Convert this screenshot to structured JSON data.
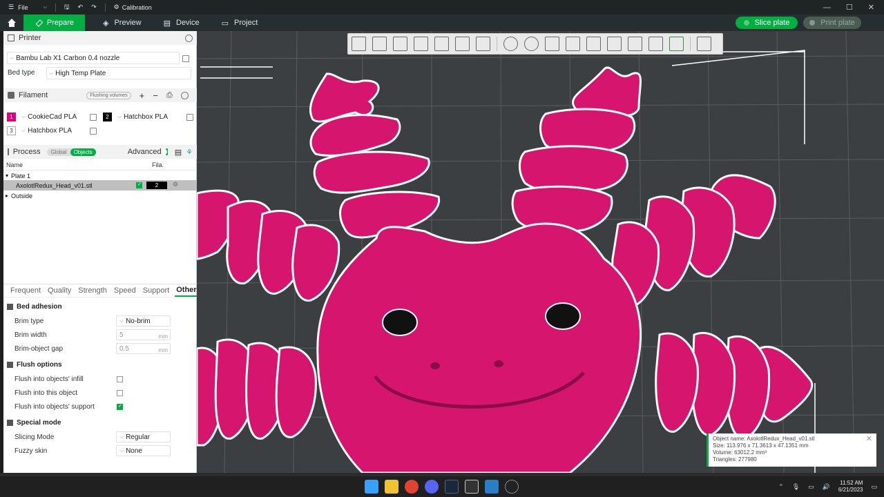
{
  "titlebar": {
    "file_label": "File",
    "project_name": "Calibration",
    "minimize_label": "—",
    "maximize_label": "☐",
    "close_label": "✕"
  },
  "tabs": {
    "prepare": "Prepare",
    "preview": "Preview",
    "device": "Device",
    "project": "Project",
    "slice_plate": "Slice plate",
    "print_plate": "Print plate"
  },
  "printer": {
    "section_title": "Printer",
    "printer_name": "Bambu Lab X1 Carbon 0.4 nozzle",
    "bed_type_label": "Bed type",
    "bed_type_value": "High Temp Plate"
  },
  "filament": {
    "section_title": "Filament",
    "flushing_volumes": "Flushing volumes",
    "slots": [
      {
        "index": "1",
        "name": "CookieCad PLA",
        "color": "#e0007a"
      },
      {
        "index": "2",
        "name": "Hatchbox PLA",
        "color": "#000000"
      },
      {
        "index": "3",
        "name": "Hatchbox PLA",
        "color": "#ffffff"
      }
    ]
  },
  "process": {
    "section_title": "Process",
    "global_label": "Global",
    "objects_label": "Objects",
    "advanced_label": "Advanced",
    "col_name": "Name",
    "col_fila": "Fila.",
    "plate_label": "Plate 1",
    "object_name": "AxolotlRedux_Head_v01.stl",
    "object_fila": "2",
    "outside_label": "Outside"
  },
  "param_tabs": [
    "Frequent",
    "Quality",
    "Strength",
    "Speed",
    "Support",
    "Others"
  ],
  "others": {
    "bed_adhesion": "Bed adhesion",
    "brim_type_label": "Brim type",
    "brim_type_value": "No-brim",
    "brim_width_label": "Brim width",
    "brim_width_value": "5",
    "brim_gap_label": "Brim-object gap",
    "brim_gap_value": "0.5",
    "unit_mm": "mm",
    "flush_options": "Flush options",
    "flush_infill_label": "Flush into objects' infill",
    "flush_object_label": "Flush into this object",
    "flush_support_label": "Flush into objects' support",
    "special_mode": "Special mode",
    "slicing_mode_label": "Slicing Mode",
    "slicing_mode_value": "Regular",
    "fuzzy_skin_label": "Fuzzy skin",
    "fuzzy_skin_value": "None"
  },
  "object_info": {
    "name": "Object name: AxolotlRedux_Head_v01.stl",
    "size": "Size: 113.976 x 71.3613 x 47.1351 mm",
    "volume": "Volume: 63012.2 mm³",
    "triangles": "Triangles: 277980"
  },
  "taskbar": {
    "time": "11:52 AM",
    "date": "6/21/2023"
  },
  "colors": {
    "accent": "#00ae42",
    "model": "#d6156f",
    "viewport_bg": "#3c3f41"
  }
}
